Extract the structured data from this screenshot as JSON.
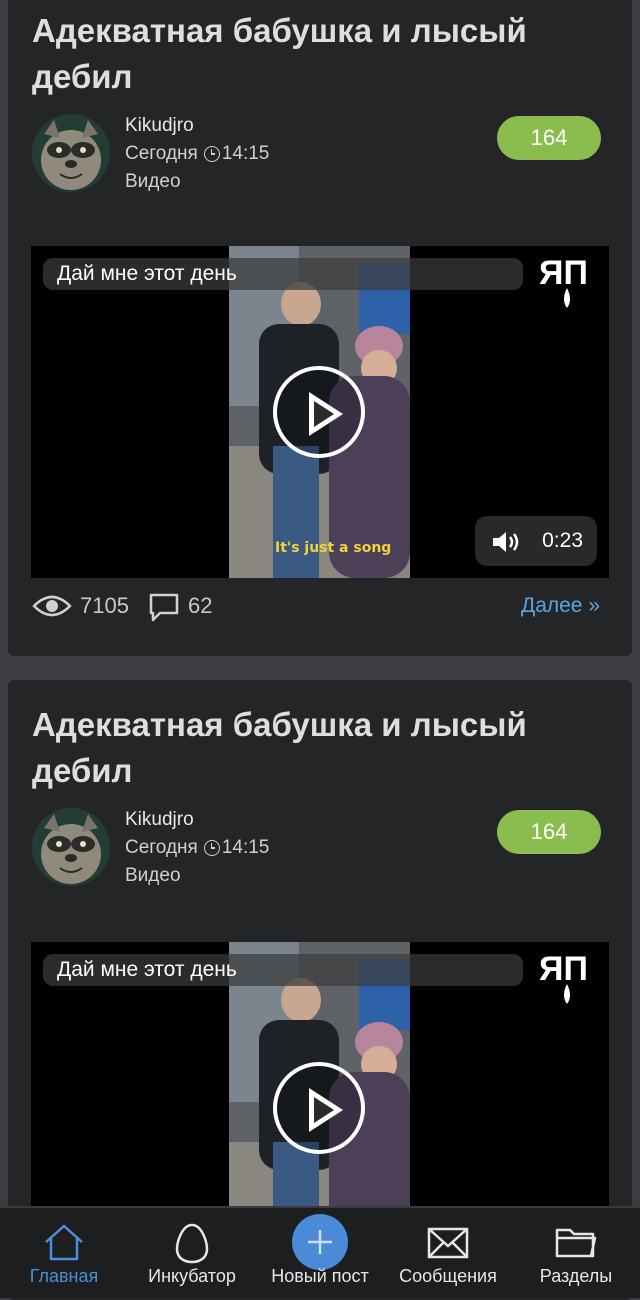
{
  "posts": [
    {
      "title": "Адекватная бабушка и лысый дебил",
      "author": "Kikudjro",
      "date": "Сегодня",
      "time": "14:15",
      "category": "Видео",
      "rating": "164",
      "video": {
        "title": "Дай мне этот день",
        "subtitle": "It's just a song",
        "duration": "0:23",
        "logo": "ЯП"
      },
      "views": "7105",
      "comments": "62",
      "more": "Далее »"
    },
    {
      "title": "Адекватная бабушка и лысый дебил",
      "author": "Kikudjro",
      "date": "Сегодня",
      "time": "14:15",
      "category": "Видео",
      "rating": "164",
      "video": {
        "title": "Дай мне этот день",
        "logo": "ЯП"
      }
    }
  ],
  "tabbar": {
    "items": [
      {
        "label": "Главная",
        "icon": "home-icon",
        "active": true
      },
      {
        "label": "Инкубатор",
        "icon": "egg-icon"
      },
      {
        "label": "Новый пост",
        "icon": "plus-icon"
      },
      {
        "label": "Сообщения",
        "icon": "envelope-icon"
      },
      {
        "label": "Разделы",
        "icon": "folder-icon"
      }
    ]
  },
  "colors": {
    "background": "#3c3d40",
    "card": "#242527",
    "rating": "#8bbd4e",
    "link": "#5aa5df",
    "active_tab": "#4a90d9",
    "fab": "#4a8ad6"
  }
}
